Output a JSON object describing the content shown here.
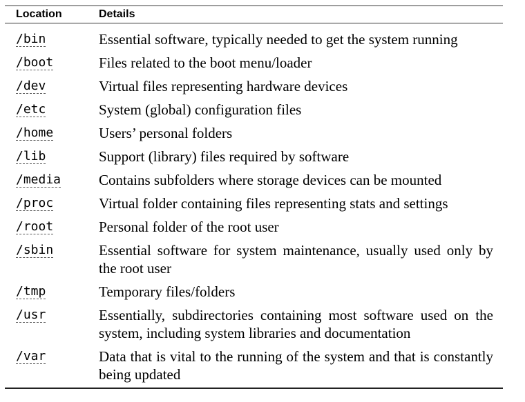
{
  "table": {
    "headers": {
      "location": "Location",
      "details": "Details"
    },
    "rows": [
      {
        "location": "/bin",
        "details": "Essential software, typically needed to get the system running"
      },
      {
        "location": "/boot",
        "details": "Files related to the boot menu/loader"
      },
      {
        "location": "/dev",
        "details": "Virtual files representing hardware devices"
      },
      {
        "location": "/etc",
        "details": "System (global) configuration files"
      },
      {
        "location": "/home",
        "details": "Users’ personal folders"
      },
      {
        "location": "/lib",
        "details": "Support (library) files required by software"
      },
      {
        "location": "/media",
        "details": "Contains subfolders where storage devices can be mounted"
      },
      {
        "location": "/proc",
        "details": "Virtual folder containing files representing stats and settings"
      },
      {
        "location": "/root",
        "details": "Personal folder of the root user"
      },
      {
        "location": "/sbin",
        "details": "Essential software for system maintenance, usually used only by the root user"
      },
      {
        "location": "/tmp",
        "details": "Temporary files/folders"
      },
      {
        "location": "/usr",
        "details": "Essentially, subdirectories containing most software used on the system, including system libraries and documentation"
      },
      {
        "location": "/var",
        "details": "Data that is vital to the running of the system and that is constantly being updated"
      }
    ]
  }
}
